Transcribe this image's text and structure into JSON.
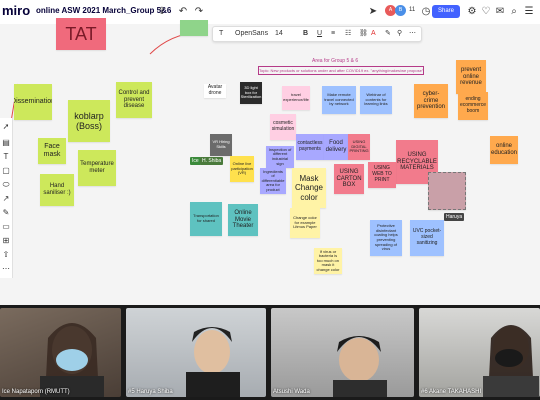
{
  "app": {
    "logo": "miro",
    "board_title": "online ASW 2021 March_Group 5&6"
  },
  "topbar": {
    "share_label": "Share",
    "avatar_count": "11"
  },
  "format_toolbar": {
    "font_name": "OpenSans",
    "font_size": "14"
  },
  "board": {
    "area_title": "Area for Group 5 & 6",
    "area_topic": "Topic: New products or solutions under and after COVID19 ex. \"anything/makes/we propose\"",
    "stickies": [
      {
        "text": "TAT",
        "color": "#f06a7c"
      },
      {
        "text": "",
        "color": "#8fd48a"
      },
      {
        "text": "Dissemination",
        "color": "#cde85b"
      },
      {
        "text": "koblarp (Boss)",
        "color": "#cde85b"
      },
      {
        "text": "Control and prevent disease",
        "color": "#cde85b"
      },
      {
        "text": "Face mask",
        "color": "#cde85b"
      },
      {
        "text": "Temperature meter",
        "color": "#cde85b"
      },
      {
        "text": "Hand saniliser :)",
        "color": "#cde85b"
      },
      {
        "text": "Avatar drone",
        "color": "#ffffff"
      },
      {
        "text": "3D light box for Sterilization",
        "color": "#2b2b2b"
      },
      {
        "text": "travel experience/life",
        "color": "#ffcfe3"
      },
      {
        "text": "Make remote travel connected by network",
        "color": "#9ec1ff"
      },
      {
        "text": "Webinar of contents for learning links",
        "color": "#9ec1ff"
      },
      {
        "text": "cyber-crime prevention",
        "color": "#ffa94d"
      },
      {
        "text": "prevent online revenue",
        "color": "#ffa94d"
      },
      {
        "text": "ending ecommerce boom",
        "color": "#ffa94d"
      },
      {
        "text": "cosmetic simulation",
        "color": "#ffcfe3"
      },
      {
        "text": "contactless payments",
        "color": "#a8a8ff"
      },
      {
        "text": "Food delivery",
        "color": "#a8a8ff"
      },
      {
        "text": "USING DIGITAL PRINTING",
        "color": "#f27b8c"
      },
      {
        "text": "USING RECYCLABLE MATERIALS",
        "color": "#f27b8c"
      },
      {
        "text": "online education",
        "color": "#ffa94d"
      },
      {
        "text": "VR Hiring Skills",
        "color": "#6b6b6b"
      },
      {
        "text": "Online live participation (VR)",
        "color": "#ffe14d"
      },
      {
        "text": "Inspection of different industrial sign",
        "color": "#a8a8ff"
      },
      {
        "text": "Ingredients of differentiable area for product",
        "color": "#a8a8ff"
      },
      {
        "text": "Mask Change color",
        "color": "#fff3a6"
      },
      {
        "text": "USING CARTON BOX",
        "color": "#f27b8c"
      },
      {
        "text": "USING WEB TO PRINT",
        "color": "#f27b8c"
      },
      {
        "text": "Transportation for shared",
        "color": "#5ec2c0"
      },
      {
        "text": "Online Movie Theater",
        "color": "#5ec2c0"
      },
      {
        "text": "Change color for example Litmus Paper",
        "color": "#fff3a6"
      },
      {
        "text": "Protective disinfectant coating helps preventing spreading of virus",
        "color": "#9ec1ff"
      },
      {
        "text": "UVC pocket-sized sanitizing",
        "color": "#9ec1ff"
      },
      {
        "text": "If virus or bacteria is too much on mask it change color",
        "color": "#fff3a6"
      },
      {
        "text": "",
        "color": "#c9a0a8"
      }
    ],
    "name_tags": [
      "Ice",
      "H. Shiba",
      "Haruya"
    ]
  },
  "participants": [
    {
      "name": "Ice Napataporn (RMUTT)"
    },
    {
      "name": "#5 Haruya Shiba"
    },
    {
      "name": "Atsushi Wada"
    },
    {
      "name": "#6 Akane TAKAHASHI"
    }
  ],
  "colors": {
    "miro_blue": "#4262ff",
    "area_pink": "#b53a88"
  }
}
